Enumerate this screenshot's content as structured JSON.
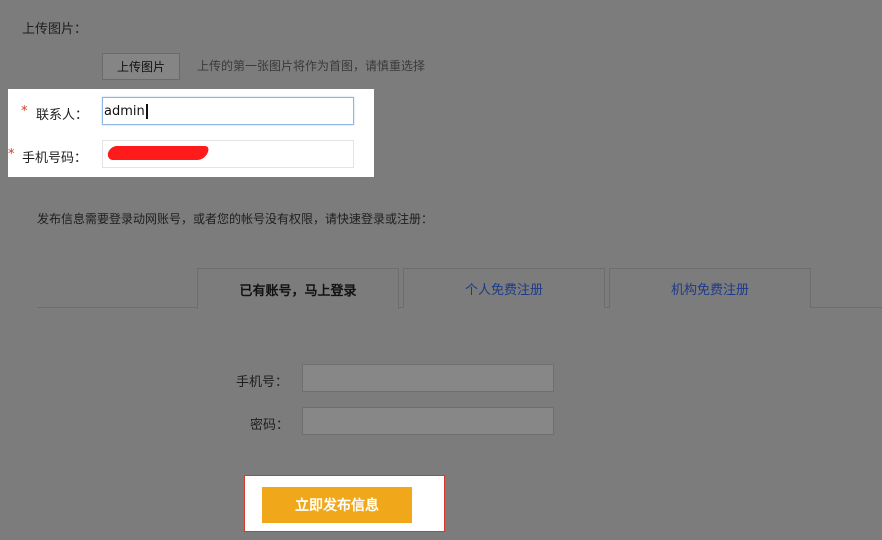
{
  "upload": {
    "label": "上传图片：",
    "button": "上传图片",
    "hint": "上传的第一张图片将作为首图，请慎重选择"
  },
  "contact": {
    "required_mark": "*",
    "label": "联系人：",
    "value": "admin"
  },
  "phone": {
    "required_mark": "*",
    "label": "手机号码："
  },
  "login_notice": "发布信息需要登录动网账号，或者您的帐号没有权限，请快速登录或注册：",
  "tabs": [
    {
      "label": "已有账号，马上登录",
      "active": true
    },
    {
      "label": "个人免费注册",
      "active": false
    },
    {
      "label": "机构免费注册",
      "active": false
    }
  ],
  "login_form": {
    "mobile_label": "手机号：",
    "password_label": "密码："
  },
  "submit_label": "立即发布信息",
  "colors": {
    "overlay": "#7c7c7c",
    "accent": "#f0a81a",
    "required": "#d9371f",
    "link": "#1d3a8a",
    "redaction": "#ff1b1b"
  }
}
